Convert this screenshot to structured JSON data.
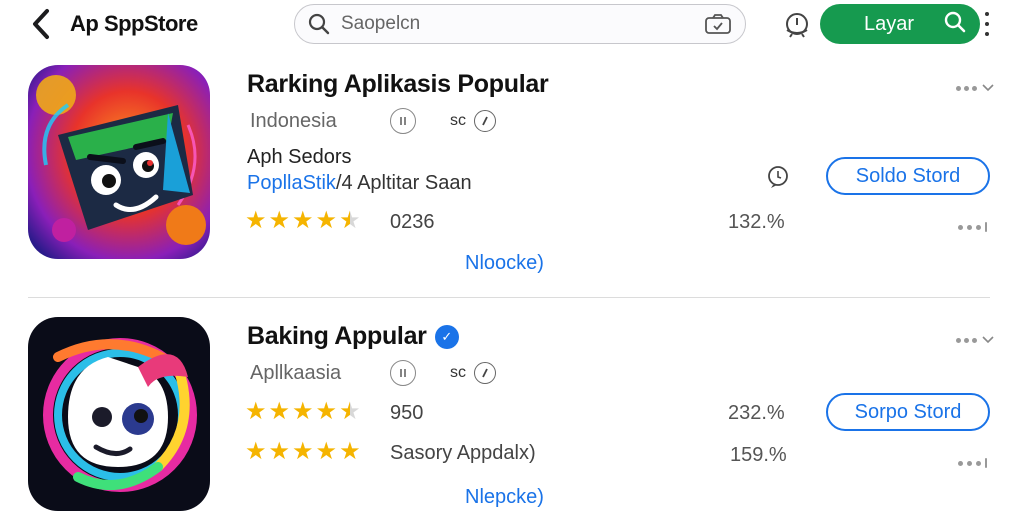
{
  "header": {
    "app_title": "Ap SppStore",
    "search_placeholder": "Saopelcn",
    "layar_label": "Layar"
  },
  "apps": [
    {
      "name": "Rarking Aplikasis Popular",
      "meta_text": "Indonesia",
      "meta_age": "sc",
      "sub_title": "Aph Sedors",
      "developer_link": "PopllaStik",
      "developer_rest": "/4 Apltitar Saan",
      "rating_count": "0236",
      "rating_stars": 4.5,
      "percent": "132.%",
      "button_label": "Soldo Stord",
      "more_link": "Nloocke)",
      "icon": "game-character-icon"
    },
    {
      "name": "Baking Appular",
      "meta_text": "Apllkaasia",
      "meta_age": "sc",
      "rating_count": "950",
      "rating_stars": 4.5,
      "percent": "232.%",
      "button_label": "Sorpo Stord",
      "rating_text": "Sasory Appdalx)",
      "percent_2": "159.%",
      "more_link": "Nlepcke)",
      "icon": "rainbow-bird-icon"
    }
  ],
  "colors": {
    "accent_green": "#169a4f",
    "link_blue": "#1a73e8",
    "star_gold": "#f5b400"
  }
}
